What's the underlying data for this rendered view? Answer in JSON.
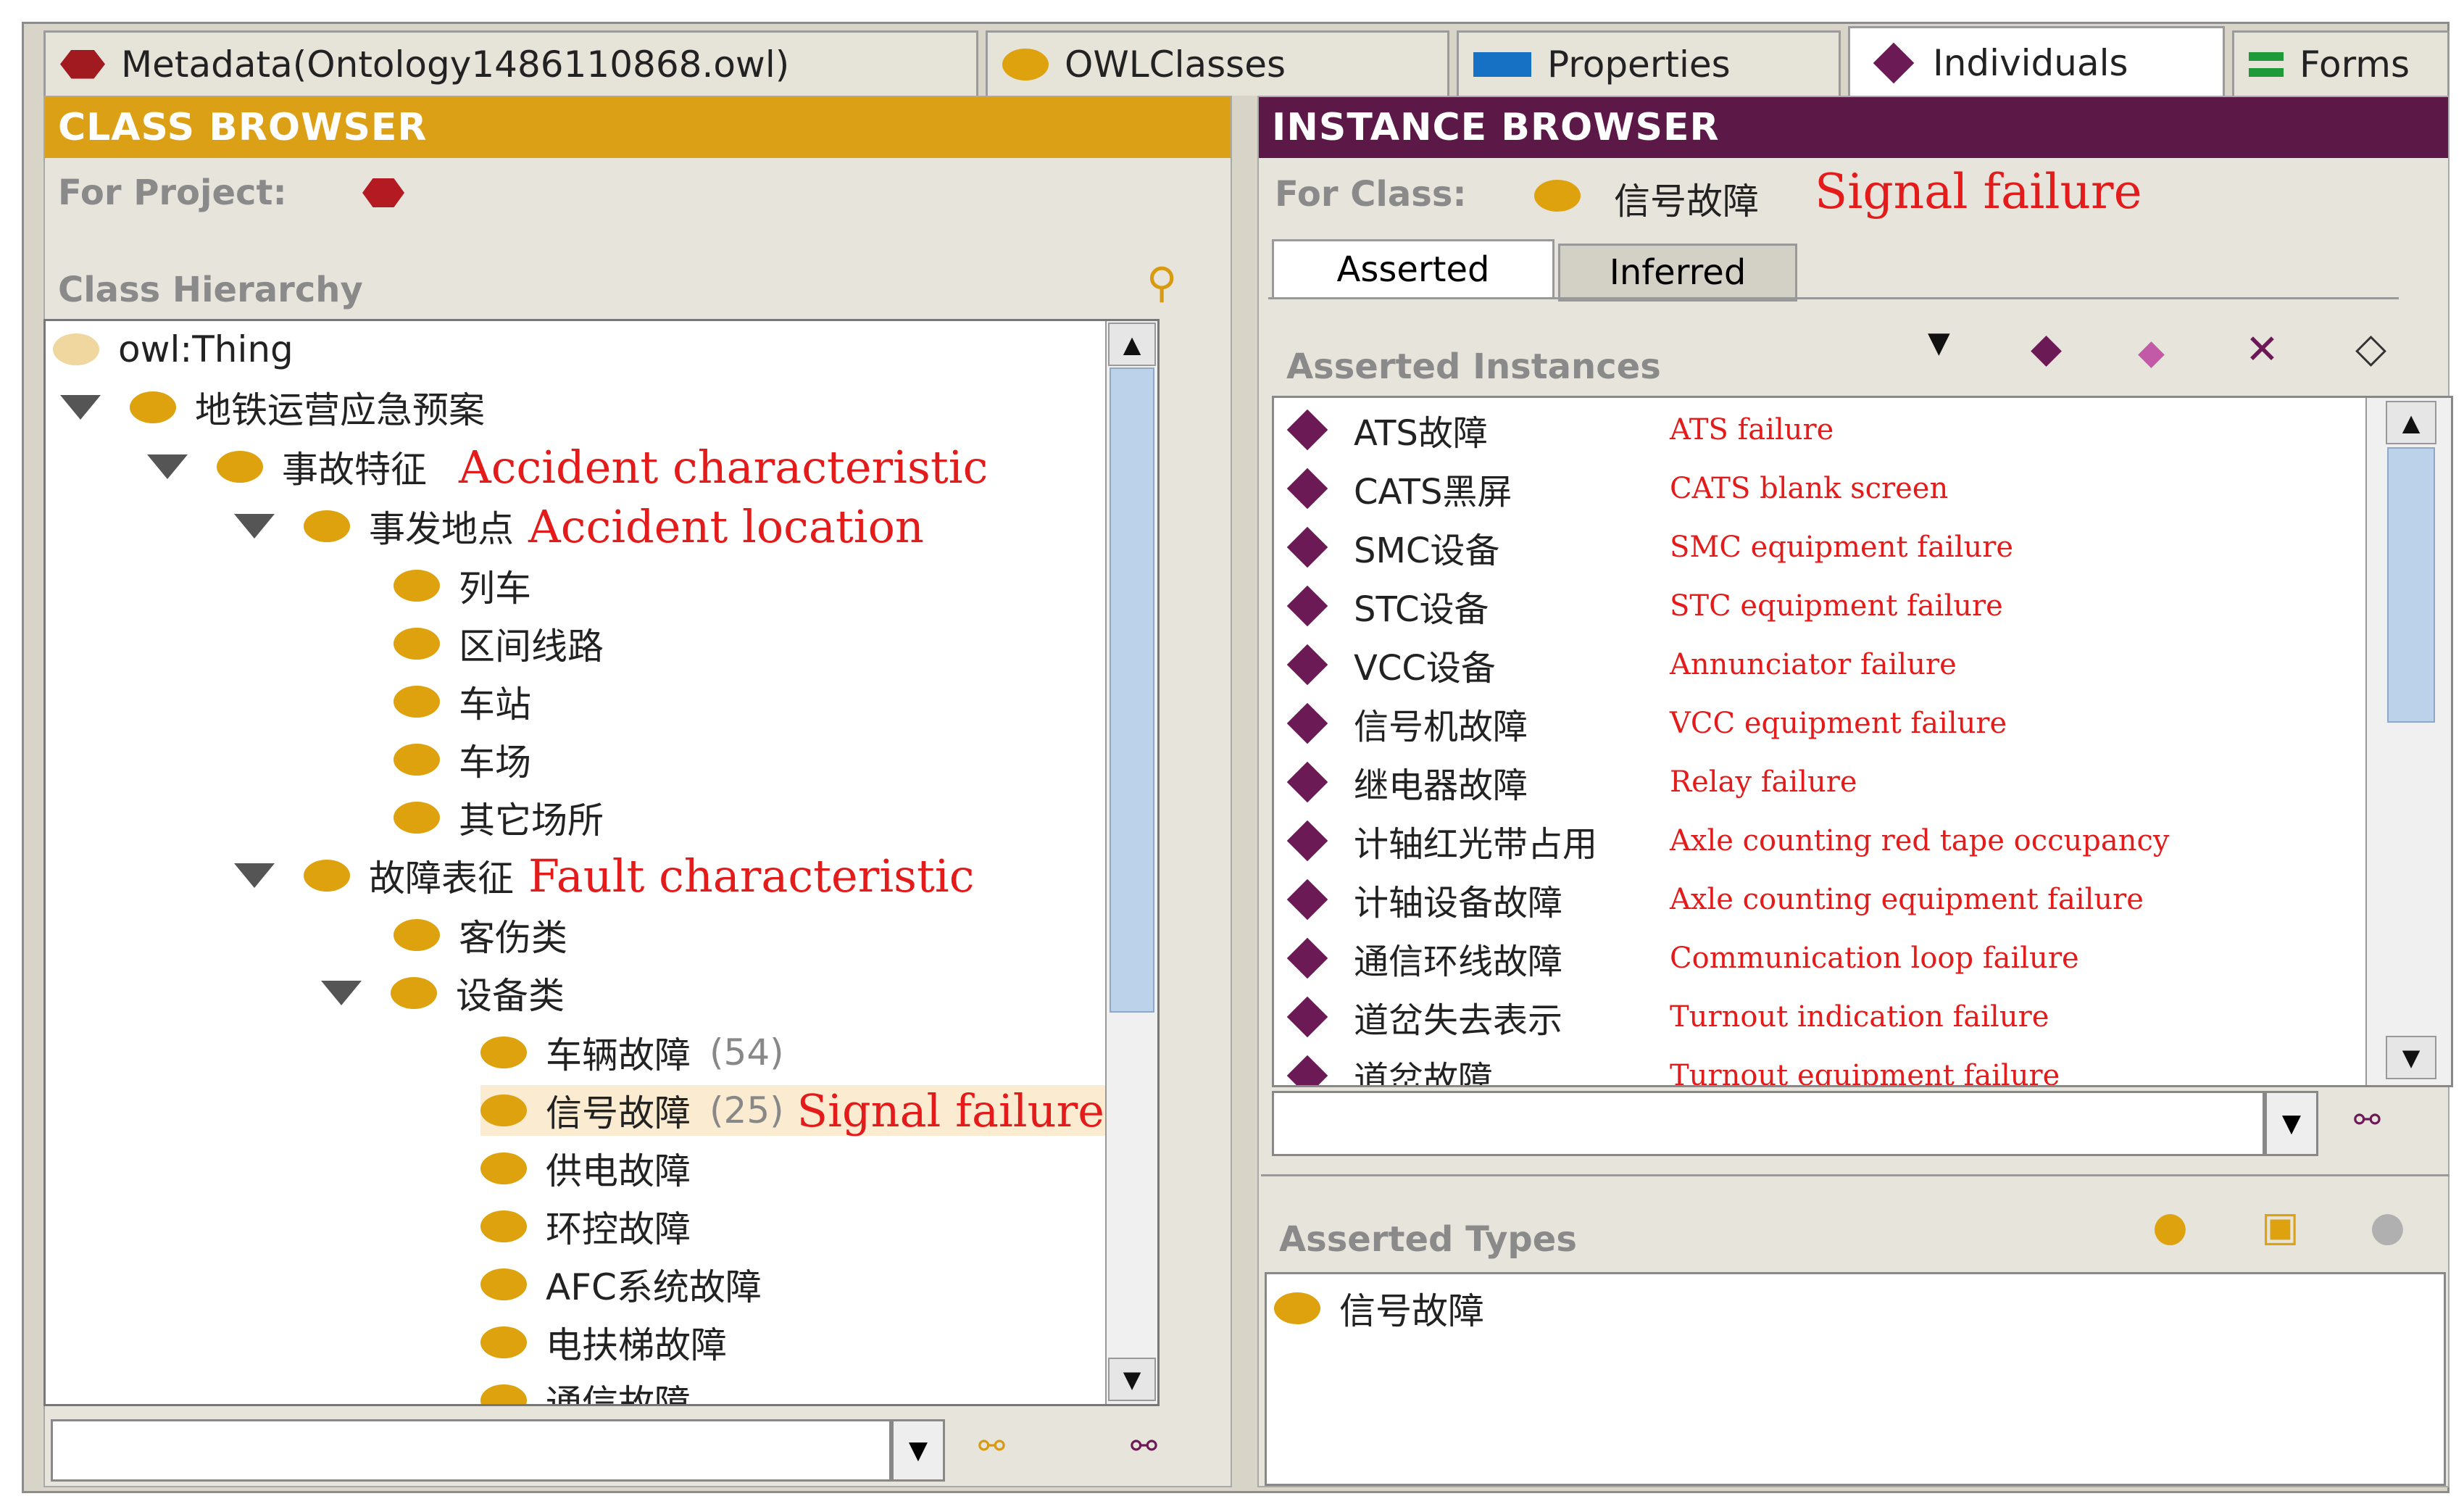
{
  "tabs": [
    {
      "label": "Metadata(Ontology1486110868.owl)",
      "icon": "ontology-hex-icon"
    },
    {
      "label": "OWLClasses",
      "icon": "class-dot-icon"
    },
    {
      "label": "Properties",
      "icon": "property-rect-icon"
    },
    {
      "label": "Individuals",
      "icon": "individual-diamond-icon",
      "selected": true
    },
    {
      "label": "Forms",
      "icon": "forms-icon"
    }
  ],
  "class_browser": {
    "title": "CLASS BROWSER",
    "for_project": "For Project:",
    "hierarchy_label": "Class Hierarchy",
    "tree": [
      {
        "label": "owl:Thing"
      },
      {
        "label": "地铁运营应急预案"
      },
      {
        "label": "事故特征",
        "annotation": "Accident characteristic"
      },
      {
        "label": "事发地点",
        "annotation": "Accident location"
      },
      {
        "label": "列车"
      },
      {
        "label": "区间线路"
      },
      {
        "label": "车站"
      },
      {
        "label": "车场"
      },
      {
        "label": "其它场所"
      },
      {
        "label": "故障表征",
        "annotation": "Fault characteristic"
      },
      {
        "label": "客伤类"
      },
      {
        "label": "设备类"
      },
      {
        "label": "车辆故障",
        "count": "(54)"
      },
      {
        "label": "信号故障",
        "count": "(25)",
        "annotation": "Signal failure",
        "selected": true
      },
      {
        "label": "供电故障"
      },
      {
        "label": "环控故障"
      },
      {
        "label": "AFC系统故障"
      },
      {
        "label": "电扶梯故障"
      },
      {
        "label": "通信故障"
      }
    ]
  },
  "instance_browser": {
    "title": "INSTANCE BROWSER",
    "for_class": "For Class:",
    "class_name": "信号故障",
    "class_annotation": "Signal failure",
    "subtabs": [
      "Asserted",
      "Inferred"
    ],
    "instances_label": "Asserted Instances",
    "instances": [
      {
        "name": "ATS故障",
        "en": "ATS failure"
      },
      {
        "name": "CATS黑屏",
        "en": "CATS blank screen"
      },
      {
        "name": "SMC设备",
        "en": "SMC equipment failure"
      },
      {
        "name": "STC设备",
        "en": "STC equipment failure"
      },
      {
        "name": "VCC设备",
        "en": "Annunciator failure"
      },
      {
        "name": "信号机故障",
        "en": "VCC equipment failure"
      },
      {
        "name": "继电器故障",
        "en": "Relay failure"
      },
      {
        "name": "计轴红光带占用",
        "en": "Axle  counting red tape occupancy"
      },
      {
        "name": "计轴设备故障",
        "en": "Axle counting equipment failure"
      },
      {
        "name": "通信环线故障",
        "en": "Communication loop failure"
      },
      {
        "name": "道岔失去表示",
        "en": "Turnout indication failure"
      },
      {
        "name": "道岔故障",
        "en": "Turnout equipment failure"
      }
    ],
    "types_label": "Asserted Types",
    "types": [
      "信号故障"
    ]
  },
  "colors": {
    "class_orange": "#dda20e",
    "instance_purple": "#6b1a56",
    "annotation_red": "#e41b1b"
  }
}
